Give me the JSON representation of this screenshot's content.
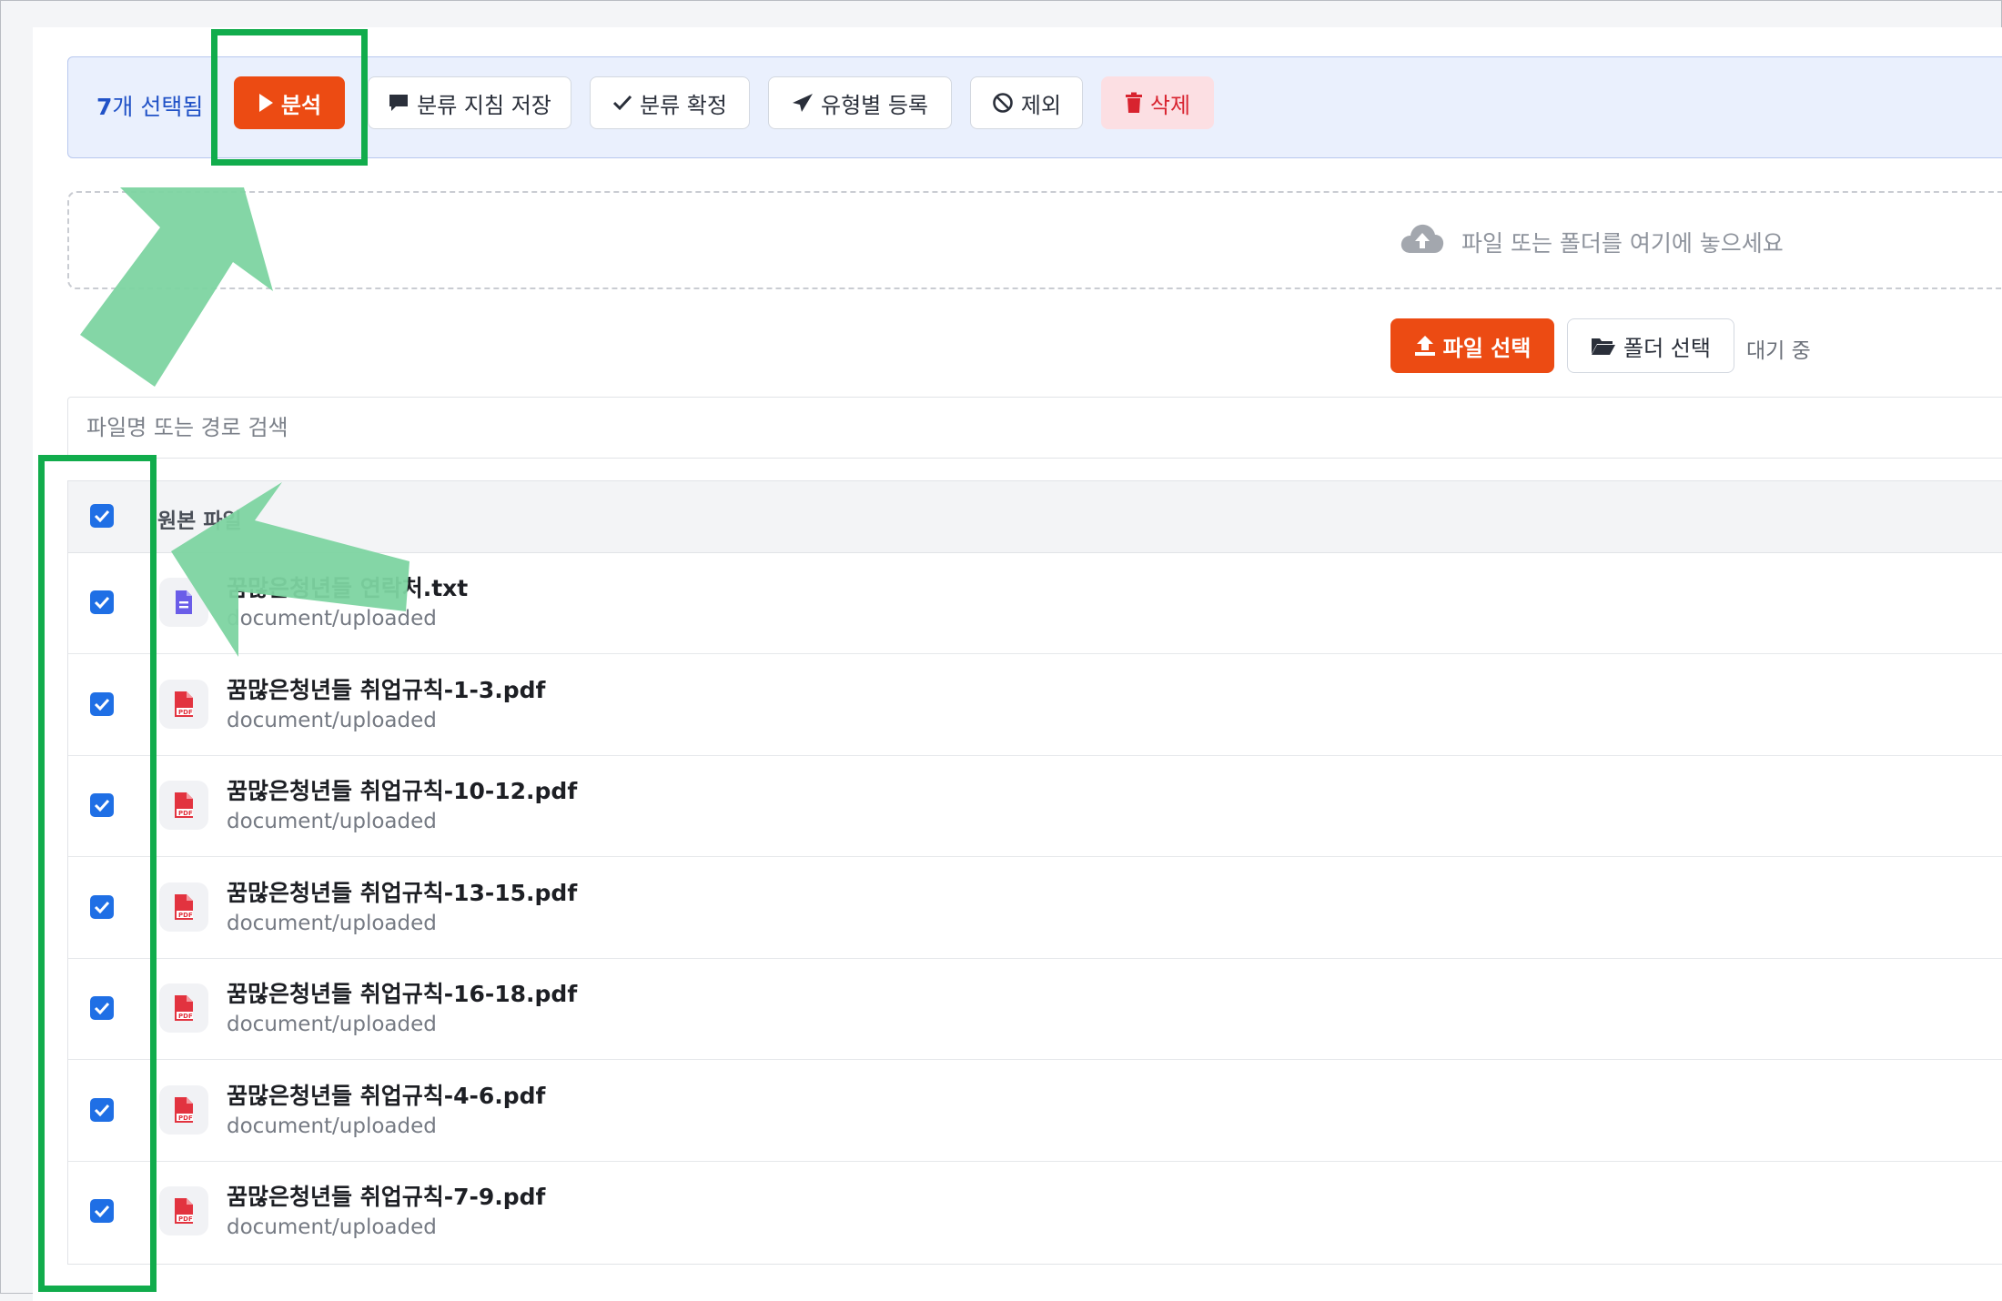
{
  "toolbar": {
    "selected_count": "7",
    "selected_label": "개 선택됨",
    "analyze_label": "분석",
    "save_guideline_label": "분류 지침 저장",
    "confirm_label": "분류 확정",
    "register_label": "유형별 등록",
    "exclude_label": "제외",
    "delete_label": "삭제"
  },
  "dropzone": {
    "text": "파일 또는 폴더를 여기에 놓으세요",
    "icon": "cloud-upload-icon"
  },
  "upload": {
    "file_select_label": "파일 선택",
    "folder_select_label": "폴더 선택",
    "status": "대기 중"
  },
  "search": {
    "placeholder": "파일명 또는 경로 검색",
    "value": ""
  },
  "table": {
    "column_header": "원본 파일",
    "header_checked": true,
    "rows": [
      {
        "name": "꿈많은청년들 연락처.txt",
        "meta": "document/uploaded",
        "type": "txt",
        "checked": true
      },
      {
        "name": "꿈많은청년들 취업규칙-1-3.pdf",
        "meta": "document/uploaded",
        "type": "pdf",
        "checked": true
      },
      {
        "name": "꿈많은청년들 취업규칙-10-12.pdf",
        "meta": "document/uploaded",
        "type": "pdf",
        "checked": true
      },
      {
        "name": "꿈많은청년들 취업규칙-13-15.pdf",
        "meta": "document/uploaded",
        "type": "pdf",
        "checked": true
      },
      {
        "name": "꿈많은청년들 취업규칙-16-18.pdf",
        "meta": "document/uploaded",
        "type": "pdf",
        "checked": true
      },
      {
        "name": "꿈많은청년들 취업규칙-4-6.pdf",
        "meta": "document/uploaded",
        "type": "pdf",
        "checked": true
      },
      {
        "name": "꿈많은청년들 취업규칙-7-9.pdf",
        "meta": "document/uploaded",
        "type": "pdf",
        "checked": true
      }
    ]
  },
  "colors": {
    "accent_orange": "#ec4b13",
    "highlight_green": "#11ac4c",
    "arrow_green": "#7dd4a1",
    "checkbox_blue": "#1f6fe5",
    "delete_red": "#d8232f"
  }
}
